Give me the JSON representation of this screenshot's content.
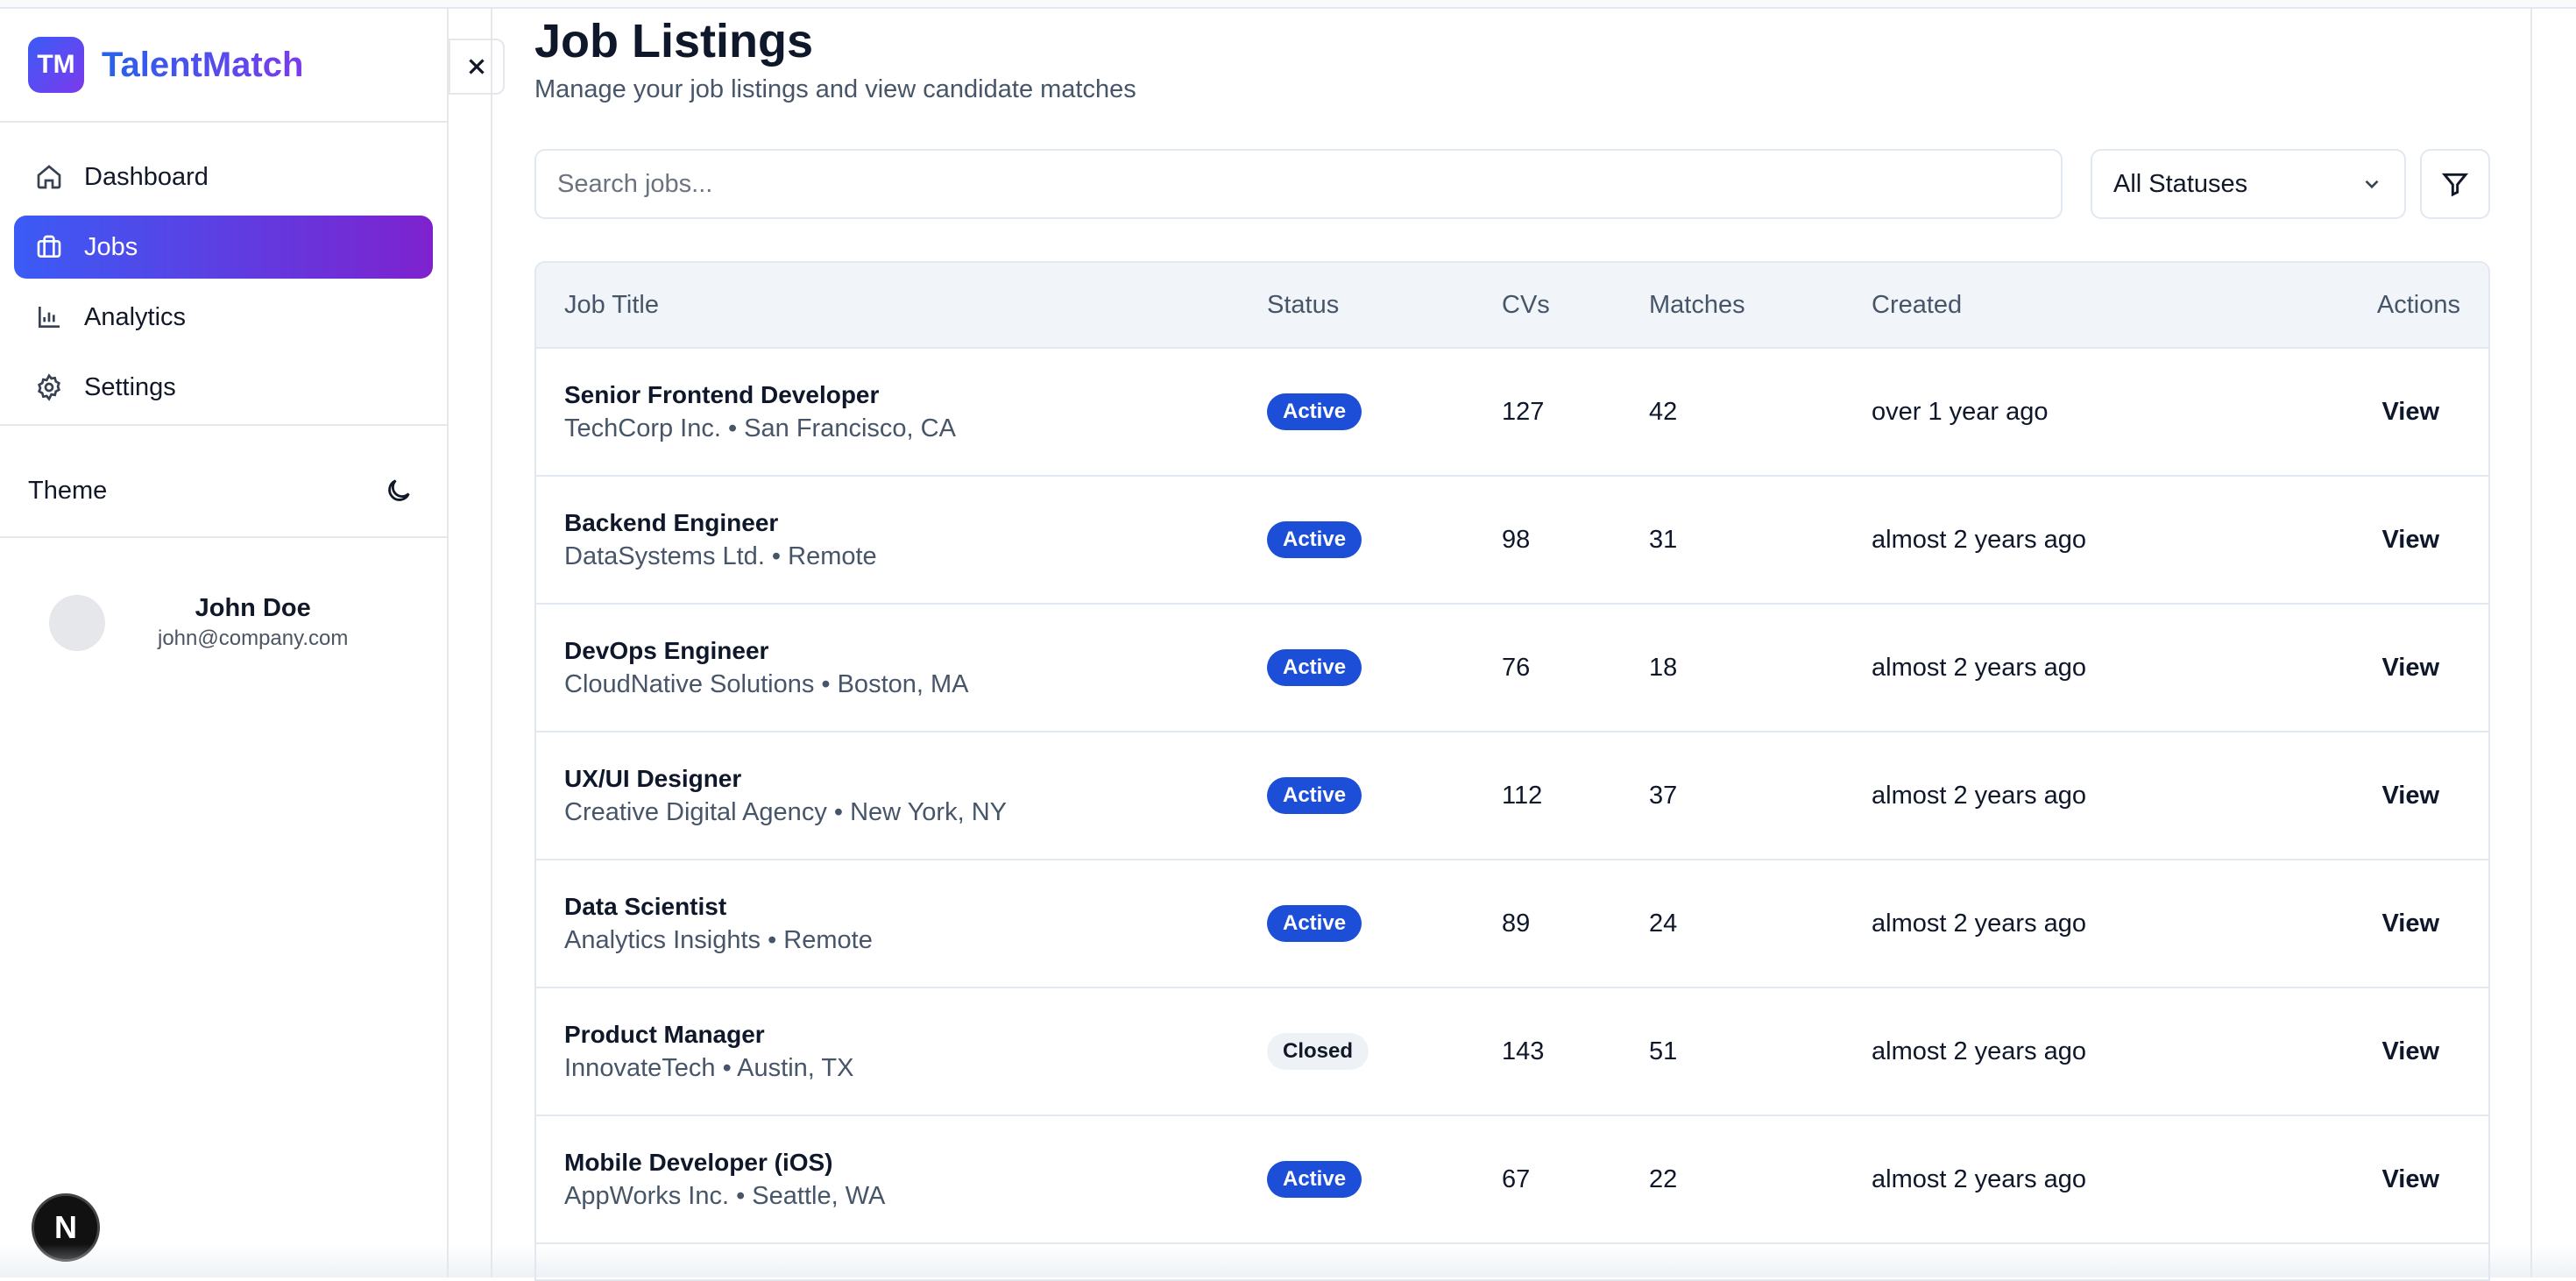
{
  "app": {
    "logo_text": "TM",
    "name": "TalentMatch"
  },
  "sidebar": {
    "items": [
      {
        "label": "Dashboard",
        "icon": "home-icon"
      },
      {
        "label": "Jobs",
        "icon": "briefcase-icon"
      },
      {
        "label": "Analytics",
        "icon": "bar-chart-icon"
      },
      {
        "label": "Settings",
        "icon": "gear-icon"
      }
    ],
    "active_index": 1,
    "theme_label": "Theme",
    "user": {
      "name": "John Doe",
      "email": "john@company.com"
    }
  },
  "dev_badge": "N",
  "page": {
    "title": "Job Listings",
    "subtitle": "Manage your job listings and view candidate matches"
  },
  "search": {
    "placeholder": "Search jobs...",
    "value": ""
  },
  "status_filter": {
    "selected": "All Statuses"
  },
  "table": {
    "headers": [
      "Job Title",
      "Status",
      "CVs",
      "Matches",
      "Created",
      "Actions"
    ],
    "rows": [
      {
        "title": "Senior Frontend Developer",
        "meta": "TechCorp Inc. • San Francisco, CA",
        "status": "Active",
        "cvs": "127",
        "matches": "42",
        "created": "over 1 year ago",
        "action": "View"
      },
      {
        "title": "Backend Engineer",
        "meta": "DataSystems Ltd. • Remote",
        "status": "Active",
        "cvs": "98",
        "matches": "31",
        "created": "almost 2 years ago",
        "action": "View"
      },
      {
        "title": "DevOps Engineer",
        "meta": "CloudNative Solutions • Boston, MA",
        "status": "Active",
        "cvs": "76",
        "matches": "18",
        "created": "almost 2 years ago",
        "action": "View"
      },
      {
        "title": "UX/UI Designer",
        "meta": "Creative Digital Agency • New York, NY",
        "status": "Active",
        "cvs": "112",
        "matches": "37",
        "created": "almost 2 years ago",
        "action": "View"
      },
      {
        "title": "Data Scientist",
        "meta": "Analytics Insights • Remote",
        "status": "Active",
        "cvs": "89",
        "matches": "24",
        "created": "almost 2 years ago",
        "action": "View"
      },
      {
        "title": "Product Manager",
        "meta": "InnovateTech • Austin, TX",
        "status": "Closed",
        "cvs": "143",
        "matches": "51",
        "created": "almost 2 years ago",
        "action": "View"
      },
      {
        "title": "Mobile Developer (iOS)",
        "meta": "AppWorks Inc. • Seattle, WA",
        "status": "Active",
        "cvs": "67",
        "matches": "22",
        "created": "almost 2 years ago",
        "action": "View"
      }
    ]
  },
  "colors": {
    "accent_start": "#3b5bf6",
    "accent_end": "#7e22ce",
    "active_badge": "#1d4ed8",
    "closed_badge": "#eef2f6"
  }
}
